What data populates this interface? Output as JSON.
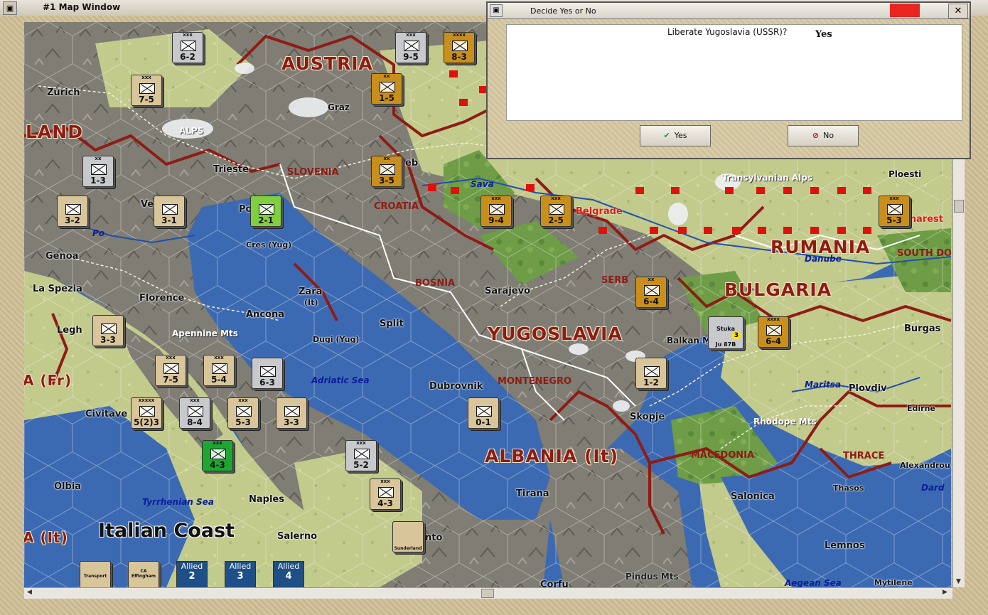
{
  "map_window": {
    "title": "#1 Map Window"
  },
  "dialog": {
    "title": "Decide Yes or No",
    "question": "Liberate Yugoslavia (USSR)?",
    "answer": "Yes",
    "yes_label": "Yes",
    "no_label": "No"
  },
  "labels": {
    "countries": [
      "AUSTRIA",
      "LAND",
      "RUMANIA",
      "BULGARIA",
      "YUGOSLAVIA",
      "ALBANIA (It)"
    ],
    "regions": [
      "SLOVENIA",
      "CROATIA",
      "BOSNIA",
      "MONTENEGRO",
      "MACEDONIA",
      "THRACE",
      "SOUTH DO",
      "SERB"
    ],
    "cities": [
      "Zurich",
      "Trieste",
      "Genoa",
      "La Spezia",
      "Florence",
      "Ancona",
      "Zara",
      "(It)",
      "Split",
      "Sarajevo",
      "Dubrovnik",
      "Skopje",
      "Tirana",
      "Salonica",
      "Plovdiv",
      "Burgas",
      "Edirne",
      "Alexandrou",
      "Thasos",
      "Lemnos",
      "Mytilene",
      "Naples",
      "Salerno",
      "Civitave",
      "Olbia",
      "Legh",
      "Ploesti",
      "Cres (Yug)",
      "Dugi (Yug)",
      "Po",
      "Ve",
      "Graz",
      "eb",
      "Balkan M",
      "nto",
      "Corfu",
      "Dard",
      "charest"
    ],
    "waters": [
      "Adriatic Sea",
      "Tyrrhenian Sea",
      "Aegean Sea",
      "Danube",
      "Sava",
      "Maritsa",
      "Po"
    ],
    "terrain": [
      "ALPS",
      "Apennine Mts",
      "Transylvanian Alps",
      "Rhodope Mts",
      "Pindus Mts"
    ],
    "enemy_city": "Belgrade",
    "coast": "Italian Coast",
    "italy_fr": "A (Fr)",
    "italy_it": "A (It)"
  },
  "counters": [
    {
      "label": "6-2",
      "size": "xxx",
      "color": "c-gray"
    },
    {
      "label": "7-5",
      "size": "xxx",
      "color": "c-tan"
    },
    {
      "label": "1-5",
      "size": "xx",
      "color": "c-gold"
    },
    {
      "label": "9-5",
      "size": "xxx",
      "color": "c-gray"
    },
    {
      "label": "8-3",
      "size": "xxxx",
      "color": "c-gold"
    },
    {
      "label": "1-3",
      "size": "xx",
      "color": "c-gray"
    },
    {
      "label": "3-5",
      "size": "xx",
      "color": "c-gold"
    },
    {
      "label": "3-2",
      "size": "",
      "color": "c-tan"
    },
    {
      "label": "3-1",
      "size": "",
      "color": "c-tan"
    },
    {
      "label": "2-1",
      "size": "",
      "color": "c-lime"
    },
    {
      "label": "9-4",
      "size": "xxx",
      "color": "c-gold"
    },
    {
      "label": "2-5",
      "size": "xxx",
      "color": "c-gold"
    },
    {
      "label": "5-3",
      "size": "xxx",
      "color": "c-gold"
    },
    {
      "label": "6-4",
      "size": "xx",
      "color": "c-gold"
    },
    {
      "label": "6-4",
      "size": "xxxx",
      "color": "c-gold"
    },
    {
      "label": "7-5",
      "size": "xxx",
      "color": "c-tan"
    },
    {
      "label": "5-4",
      "size": "xxx",
      "color": "c-tan"
    },
    {
      "label": "6-3",
      "size": "",
      "color": "c-gray"
    },
    {
      "label": "1-2",
      "size": "",
      "color": "c-tan"
    },
    {
      "label": "5(2)3",
      "size": "xxxxx",
      "color": "c-tan"
    },
    {
      "label": "8-4",
      "size": "xxx",
      "color": "c-gray"
    },
    {
      "label": "5-3",
      "size": "xxx",
      "color": "c-tan"
    },
    {
      "label": "3-3",
      "size": "",
      "color": "c-tan"
    },
    {
      "label": "0-1",
      "size": "",
      "color": "c-tan"
    },
    {
      "label": "4-3",
      "size": "xxx",
      "color": "c-green"
    },
    {
      "label": "5-2",
      "size": "xxx",
      "color": "c-gray"
    },
    {
      "label": "4-3",
      "size": "xxx",
      "color": "c-tan"
    },
    {
      "label": "3-3",
      "size": "",
      "color": "c-tan"
    }
  ],
  "allied_boxes": [
    {
      "label": "Allied",
      "value": "2"
    },
    {
      "label": "Allied",
      "value": "3"
    },
    {
      "label": "Allied",
      "value": "4"
    }
  ],
  "air_unit": {
    "name": "Ju 87B",
    "label": "Stuka",
    "value": "3"
  },
  "naval_units": [
    "Transport",
    "CA Effingham",
    "Sunderland"
  ],
  "colors": {
    "sea": "#3c6ab2",
    "mountain": "#7a7a72",
    "plain": "#b9c98a",
    "border": "#8e1c14",
    "enemy_flag": "#e0100c"
  }
}
